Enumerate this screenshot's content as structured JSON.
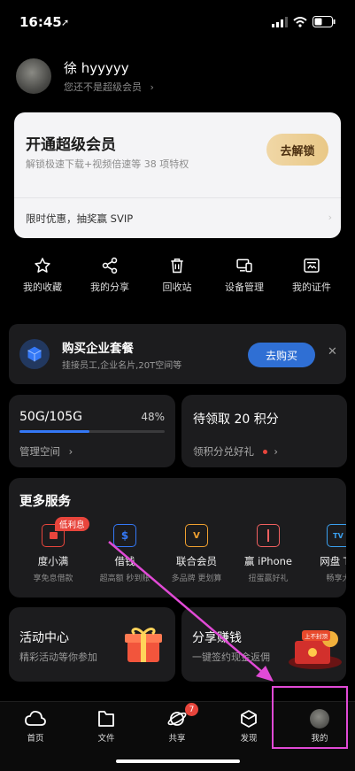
{
  "status_bar": {
    "time": "16:45"
  },
  "profile": {
    "name": "徐 hyyyyy",
    "subtitle": "您还不是超级会员"
  },
  "vip_card": {
    "title": "开通超级会员",
    "subtitle": "解锁极速下载+视频倍速等 38 项特权",
    "unlock_label": "去解锁",
    "promo": "限时优惠，抽奖赢 SVIP"
  },
  "quick_actions": [
    {
      "label": "我的收藏",
      "icon": "star-icon"
    },
    {
      "label": "我的分享",
      "icon": "share-icon"
    },
    {
      "label": "回收站",
      "icon": "trash-icon"
    },
    {
      "label": "设备管理",
      "icon": "devices-icon"
    },
    {
      "label": "我的证件",
      "icon": "id-card-icon"
    }
  ],
  "enterprise": {
    "title": "购买企业套餐",
    "subtitle": "挂接员工,企业名片,20T空间等",
    "button": "去购买"
  },
  "storage": {
    "value": "50G/105G",
    "percent_label": "48%",
    "fraction": 0.48,
    "manage_label": "管理空间"
  },
  "points": {
    "title": "待领取 20 积分",
    "subtitle": "领积分兑好礼"
  },
  "more_services": {
    "title": "更多服务",
    "badge": "低利息",
    "items": [
      {
        "name": "度小满",
        "sub": "享免息借款",
        "icon": "wallet-icon",
        "color": "#e8453c"
      },
      {
        "name": "借钱",
        "sub": "超高额 秒到账",
        "icon": "money-bag-icon",
        "color": "#3478f6"
      },
      {
        "name": "联合会员",
        "sub": "多品牌 更划算",
        "icon": "vip-card-icon",
        "color": "#f0a030"
      },
      {
        "name": "赢 iPhone",
        "sub": "扭蛋赢好礼",
        "icon": "gift-icon",
        "color": "#f06060"
      },
      {
        "name": "网盘 TV",
        "sub": "畅享大",
        "icon": "tv-icon",
        "color": "#3aa0f0"
      }
    ]
  },
  "activity": {
    "title": "活动中心",
    "subtitle": "精彩活动等你参加"
  },
  "share_earn": {
    "title": "分享赚钱",
    "subtitle": "一键签约现金返佣",
    "tag": "上不封顶"
  },
  "tabs": [
    {
      "label": "首页",
      "icon": "cloud-icon"
    },
    {
      "label": "文件",
      "icon": "folder-icon"
    },
    {
      "label": "共享",
      "icon": "planet-icon"
    },
    {
      "label": "发现",
      "icon": "cube-icon"
    },
    {
      "label": "我的",
      "icon": "avatar-icon"
    }
  ],
  "share_badge": "7",
  "colors": {
    "accent": "#3478f6",
    "annotation": "#e14ad6",
    "gold": "#e9c887"
  }
}
